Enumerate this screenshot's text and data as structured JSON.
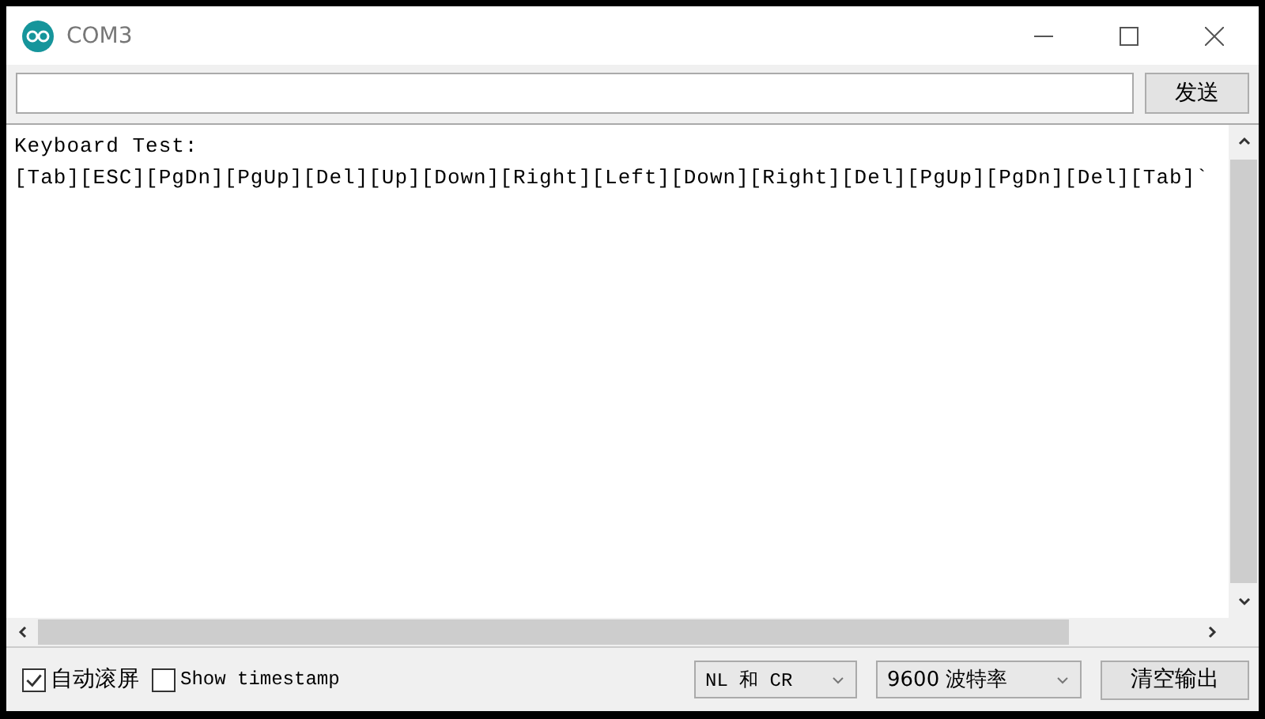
{
  "window": {
    "title": "COM3"
  },
  "send_button": "发送",
  "output": [
    "Keyboard Test:",
    "[Tab][ESC][PgDn][PgUp][Del][Up][Down][Right][Left][Down][Right][Del][PgUp][PgDn][Del][Tab]`"
  ],
  "autoscroll": {
    "label": "自动滚屏",
    "checked": true
  },
  "timestamp": {
    "label": "Show timestamp",
    "checked": false
  },
  "line_ending": "NL 和 CR",
  "baud_rate": "9600 波特率",
  "clear_button": "清空输出"
}
